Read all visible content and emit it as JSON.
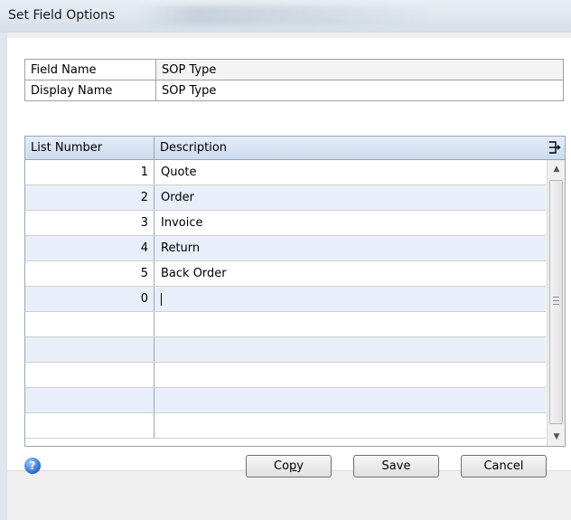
{
  "window": {
    "title": "Set Field Options"
  },
  "fields": {
    "field_name_label": "Field Name",
    "field_name_value": "SOP Type",
    "display_name_label": "Display Name",
    "display_name_value": "SOP Type"
  },
  "grid": {
    "columns": [
      "List Number",
      "Description"
    ],
    "rows": [
      {
        "number": "1",
        "description": "Quote"
      },
      {
        "number": "2",
        "description": "Order"
      },
      {
        "number": "3",
        "description": "Invoice"
      },
      {
        "number": "4",
        "description": "Return"
      },
      {
        "number": "5",
        "description": "Back Order"
      },
      {
        "number": "0",
        "description": ""
      },
      {
        "number": "",
        "description": ""
      },
      {
        "number": "",
        "description": ""
      },
      {
        "number": "",
        "description": ""
      },
      {
        "number": "",
        "description": ""
      },
      {
        "number": "",
        "description": ""
      }
    ],
    "expand_icon": "expand-arrow-icon"
  },
  "footer": {
    "help_icon": "help-icon",
    "copy_label_pre": "Co",
    "copy_label_u": "p",
    "copy_label_post": "y",
    "save_label": "Save",
    "cancel_label": "Cancel"
  }
}
